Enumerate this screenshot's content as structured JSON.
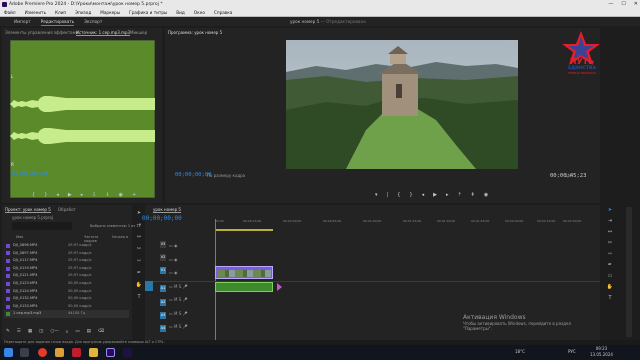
{
  "window": {
    "title": "Adobe Premiere Pro 2024 - D:\\Уроки\\монтаж\\урок номер 5.prproj *",
    "controls": [
      "—",
      "☐",
      "✕"
    ]
  },
  "menu": [
    "Файл",
    "Изменить",
    "Клип",
    "Эпизод",
    "Маркеры",
    "Графика и титры",
    "Вид",
    "Окно",
    "Справка"
  ],
  "workspace_tabs": [
    "Импорт",
    "Редактировать",
    "Экспорт"
  ],
  "source_panel": {
    "tabs": [
      "Элементы управления эффектами",
      "Источник: 1 сер.mp3.mp3",
      "Микшер"
    ],
    "active_tab": "Источник: 1 сер.mp3.mp3",
    "timecode": "02;03;03;28",
    "waveform_color": "#5a8a2a"
  },
  "program_panel": {
    "title": "Программа: урок номер 5",
    "timecode_left": "00;00;00;00",
    "fit": "По размеру кадра",
    "zoom": "1/4",
    "timecode_right": "00;00;45;23"
  },
  "header_center": {
    "left": "урок номер 5",
    "sep": "—",
    "right": "Отредактировано"
  },
  "watermark_logo": {
    "line1": "ПУТЬ",
    "line2": "ЕДИНСТВА",
    "line3": "ПЕРВАЯ ВЕЛИКАЯ",
    "star_color": "#e51e2a",
    "text_color": "#1f4aa8"
  },
  "project_panel": {
    "tabs": [
      "Проект: урок номер 5",
      "Обработ"
    ],
    "project_file": "урок номер 5.prproj",
    "selected_count": "Выбрано элементов: 1 из 11",
    "columns": [
      "Имя",
      "Частота кадров",
      "Начало в"
    ],
    "items": [
      {
        "name": "DJI_0896.MP4",
        "fps": "29,97 кадр/с"
      },
      {
        "name": "DJI_0897.MP4",
        "fps": "29,97 кадр/с"
      },
      {
        "name": "DJI_0117.MP4",
        "fps": "29,97 кадр/с"
      },
      {
        "name": "DJI_0119.MP4",
        "fps": "29,97 кадр/с"
      },
      {
        "name": "DJI_0121.MP4",
        "fps": "29,97 кадр/с"
      },
      {
        "name": "DJI_0123.MP4",
        "fps": "50,00 кадр/с"
      },
      {
        "name": "DJI_0124.MP4",
        "fps": "50,00 кадр/с"
      },
      {
        "name": "DJI_0132.MP4",
        "fps": "50,00 кадр/с"
      },
      {
        "name": "DJI_0133.MP4",
        "fps": "50,00 кадр/с"
      },
      {
        "name": "1 сер.mp3.mp3",
        "fps": "44100 Гц"
      }
    ]
  },
  "timeline": {
    "tab": "урок номер 5",
    "timecode": "00;00;00;00",
    "ruler": [
      "00;00",
      "00;00;15;00",
      "00;00;30;00",
      "00;00;45;00",
      "00;01;00;00",
      "00;01;15;00",
      "00;01;30;00",
      "00;01;45;00",
      "00;02;00;00",
      "00;02;15;00",
      "00;02;30;00",
      "00;02;45;00"
    ],
    "video_tracks": [
      "V3",
      "V2",
      "V1"
    ],
    "audio_tracks": [
      "A1",
      "A2",
      "A3",
      "A4"
    ],
    "clip_color": "#7b5be0",
    "audio_clip_color": "#3f8a2c"
  },
  "activation": {
    "line1": "Активация Windows",
    "line2": "Чтобы активировать Windows, перейдите в раздел \"Параметры\"."
  },
  "status_bar": "Перетащите для задания точки входа. Для пропусков удерживайте клавиши ALT и CTRL.",
  "taskbar": {
    "weather": "18°C",
    "lang": "РУС",
    "time": "09:23",
    "date": "13.05.2024"
  }
}
